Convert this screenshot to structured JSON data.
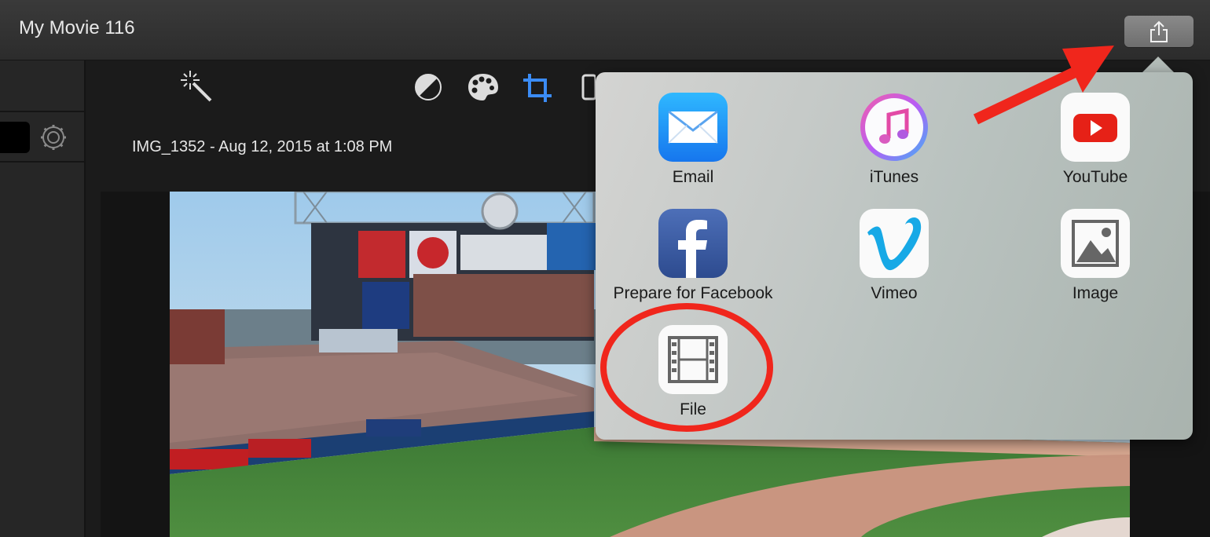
{
  "window": {
    "title": "My Movie 116"
  },
  "viewer": {
    "clip_name": "IMG_1352 - Aug 12, 2015 at 1:08 PM"
  },
  "share_menu": {
    "items": [
      {
        "label": "Email",
        "icon": "mail-icon"
      },
      {
        "label": "iTunes",
        "icon": "itunes-icon"
      },
      {
        "label": "YouTube",
        "icon": "youtube-icon"
      },
      {
        "label": "Prepare for Facebook",
        "icon": "facebook-icon"
      },
      {
        "label": "Vimeo",
        "icon": "vimeo-icon"
      },
      {
        "label": "Image",
        "icon": "image-icon"
      },
      {
        "label": "File",
        "icon": "film-icon"
      }
    ]
  },
  "colors": {
    "accent_blue": "#3b8cf5",
    "annotation_red": "#f0261c"
  }
}
